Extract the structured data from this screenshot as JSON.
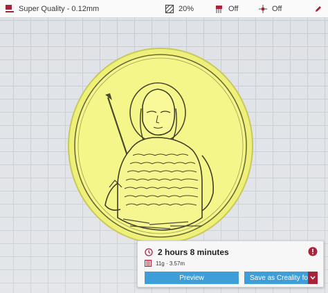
{
  "toolbar": {
    "profile_label": "Super Quality - 0.12mm",
    "infill_value": "20%",
    "support_value": "Off",
    "adhesion_value": "Off",
    "icons": {
      "profile": "profile-flag-icon",
      "infill": "infill-icon",
      "support": "support-icon",
      "adhesion": "adhesion-icon",
      "menu": "edit-icon"
    }
  },
  "job": {
    "print_time": "2 hours 8 minutes",
    "material": "11g · 3.57m"
  },
  "actions": {
    "preview_label": "Preview",
    "save_label": "Save as Creality fo..."
  },
  "colors": {
    "accent": "#a8233a",
    "button_blue": "#3e9fd8",
    "model_yellow": "#f4f48a",
    "plate": "#dfe2e6"
  }
}
